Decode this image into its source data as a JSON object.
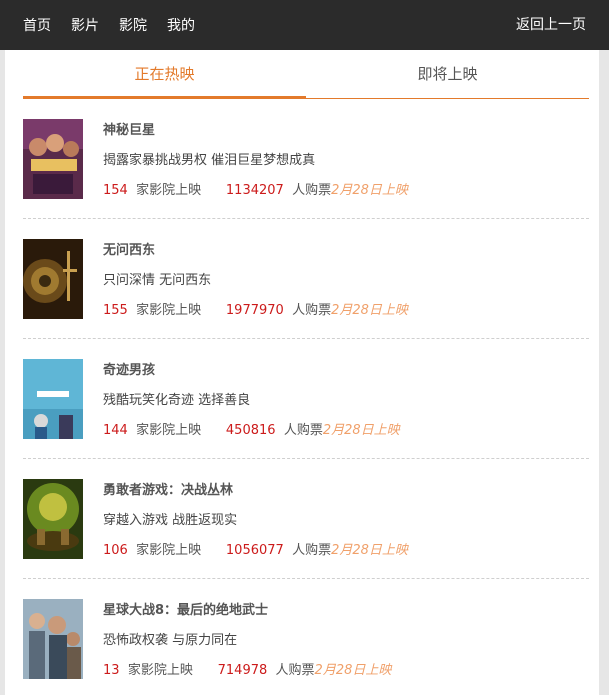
{
  "nav": {
    "items": [
      "首页",
      "影片",
      "影院",
      "我的"
    ],
    "back": "返回上一页"
  },
  "tabs": [
    "正在热映",
    "即将上映"
  ],
  "movies": [
    {
      "title": "神秘巨星",
      "desc": "揭露家暴挑战男权 催泪巨星梦想成真",
      "cinemas": "154",
      "cinemas_label": "家影院上映",
      "buyers": "1134207",
      "buyers_label": "人购票",
      "date": "2月28日上映"
    },
    {
      "title": "无问西东",
      "desc": "只问深情 无问西东",
      "cinemas": "155",
      "cinemas_label": "家影院上映",
      "buyers": "1977970",
      "buyers_label": "人购票",
      "date": "2月28日上映"
    },
    {
      "title": "奇迹男孩",
      "desc": "残酷玩笑化奇迹 选择善良",
      "cinemas": "144",
      "cinemas_label": "家影院上映",
      "buyers": "450816",
      "buyers_label": "人购票",
      "date": "2月28日上映"
    },
    {
      "title": "勇敢者游戏：决战丛林",
      "desc": "穿越入游戏 战胜返现实",
      "cinemas": "106",
      "cinemas_label": "家影院上映",
      "buyers": "1056077",
      "buyers_label": "人购票",
      "date": "2月28日上映"
    },
    {
      "title": "星球大战8：最后的绝地武士",
      "desc": "恐怖政权袭 与原力同在",
      "cinemas": "13",
      "cinemas_label": "家影院上映",
      "buyers": "714978",
      "buyers_label": "人购票",
      "date": "2月28日上映"
    }
  ],
  "colors": {
    "accent": "#e37a2b",
    "number": "#cc1b1b",
    "date": "#f0a06a",
    "topbar": "#2b2b2b"
  }
}
